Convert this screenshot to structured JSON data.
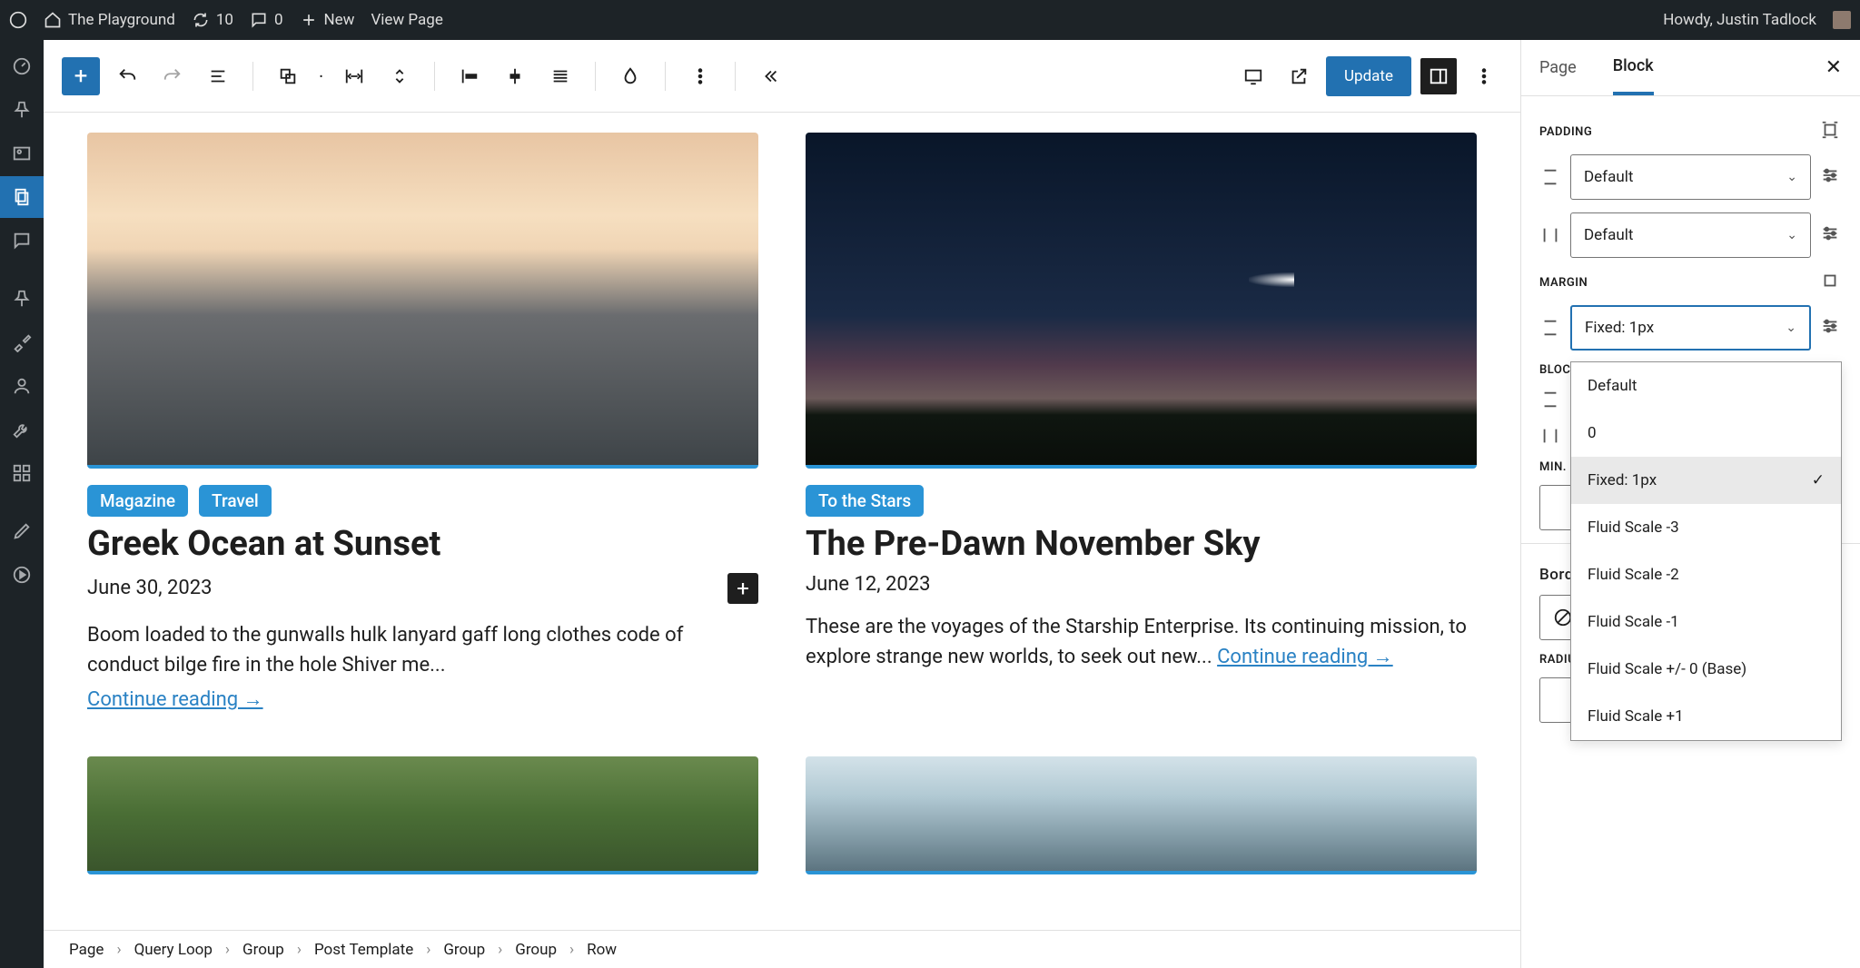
{
  "adminbar": {
    "site_name": "The Playground",
    "updates": "10",
    "comments": "0",
    "new": "New",
    "view_page": "View Page",
    "howdy": "Howdy, Justin Tadlock"
  },
  "toolbar": {
    "update_label": "Update"
  },
  "posts": [
    {
      "tags": [
        "Magazine",
        "Travel"
      ],
      "title": "Greek Ocean at Sunset",
      "date": "June 30, 2023",
      "excerpt": "Boom loaded to the gunwalls hulk lanyard gaff long clothes code of conduct bilge fire in the hole Shiver me...",
      "readmore": "Continue reading →",
      "show_add": true,
      "img": "img1"
    },
    {
      "tags": [
        "To the Stars"
      ],
      "title": "The Pre-Dawn November Sky",
      "date": "June 12, 2023",
      "excerpt_prefix": "These are the voyages of the Starship Enterprise. Its continuing mission, to explore strange new worlds, to seek out new... ",
      "readmore": "Continue reading →",
      "show_add": false,
      "img": "img2"
    }
  ],
  "breadcrumb": [
    "Page",
    "Query Loop",
    "Group",
    "Post Template",
    "Group",
    "Group",
    "Row"
  ],
  "sidebar": {
    "tabs": {
      "page": "Page",
      "block": "Block"
    },
    "padding_label": "PADDING",
    "margin_label": "MARGIN",
    "block_spacing_label": "BLOCK SPACING",
    "min_height_label": "MIN. HEIGHT",
    "border_label": "Border",
    "radius_label": "RADIUS",
    "padding_v": "Default",
    "padding_h": "Default",
    "margin_v": "Fixed: 1px",
    "options": [
      "Default",
      "0",
      "Fixed: 1px",
      "Fluid Scale -3",
      "Fluid Scale -2",
      "Fluid Scale -1",
      "Fluid Scale +/- 0 (Base)",
      "Fluid Scale +1"
    ],
    "selected": "Fixed: 1px"
  }
}
